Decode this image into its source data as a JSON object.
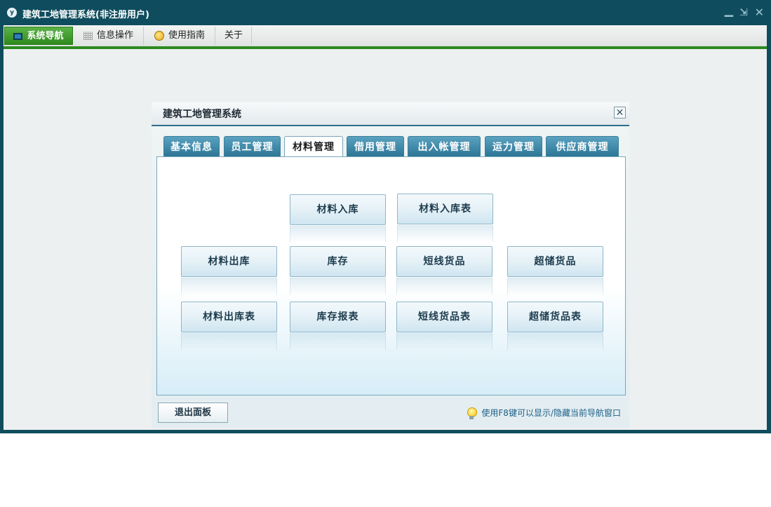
{
  "window": {
    "title": "建筑工地管理系统(非注册用户)",
    "controls": {
      "minimize": "▁",
      "restore": "⇲",
      "close": "✕"
    }
  },
  "menu": {
    "items": [
      {
        "label": "系统导航",
        "icon": "monitor-icon",
        "active": true
      },
      {
        "label": "信息操作",
        "icon": "grid-icon",
        "active": false
      },
      {
        "label": "使用指南",
        "icon": "guide-icon",
        "active": false
      },
      {
        "label": "关于",
        "icon": "",
        "active": false
      }
    ]
  },
  "dialog": {
    "title": "建筑工地管理系统",
    "close_symbol": "✕",
    "tabs": [
      {
        "label": "基本信息",
        "active": false
      },
      {
        "label": "员工管理",
        "active": false
      },
      {
        "label": "材料管理",
        "active": true
      },
      {
        "label": "借用管理",
        "active": false
      },
      {
        "label": "出入帐管理",
        "active": false
      },
      {
        "label": "运力管理",
        "active": false
      },
      {
        "label": "供应商管理",
        "active": false
      }
    ],
    "buttons": {
      "material_in": "材料入库",
      "material_in_report": "材料入库表",
      "material_out": "材料出库",
      "inventory": "库存",
      "short_goods": "短线货品",
      "over_goods": "超储货品",
      "material_out_report": "材料出库表",
      "inventory_report": "库存报表",
      "short_goods_report": "短线货品表",
      "over_goods_report": "超储货品表"
    },
    "exit_label": "退出面板",
    "tip": "使用F8键可以显示/隐藏当前导航窗口"
  }
}
